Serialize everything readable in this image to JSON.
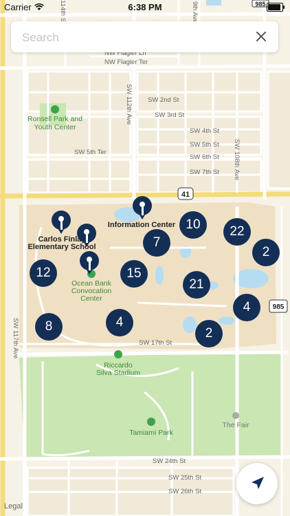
{
  "status": {
    "carrier": "Carrier",
    "time": "6:38 PM",
    "battery_level": 0.9
  },
  "search": {
    "placeholder": "Search",
    "value": ""
  },
  "map": {
    "labels": {
      "flagler_ln": "NW Flagler Ln",
      "flagler_ter": "NW Flagler Ter",
      "sw_2nd": "SW 2nd St",
      "sw_3rd": "SW 3rd St",
      "sw_4th": "SW 4th St",
      "sw_5th": "SW 5th St",
      "sw_6th": "SW 6th St",
      "sw_7th": "SW 7th St",
      "sw_5th_ter": "SW 5th Ter",
      "sw_17th": "SW 17th St",
      "sw_24th": "SW 24th St",
      "sw_25th": "SW 25th St",
      "sw_26th": "SW 26th St",
      "sw_112th": "SW 112th Ave",
      "sw_108th": "SW 108th Ave",
      "sw_117th": "SW 117th Ave",
      "ave_109": "9th Ave",
      "ave_114": "114th St",
      "ronsell": [
        "Ronsell Park and",
        "Youth Center"
      ],
      "carlos": [
        "Carlos Finlay",
        "Elementary School"
      ],
      "info_center": "Information Center",
      "ocean_bank": [
        "Ocean Bank",
        "Convocation",
        "Center"
      ],
      "riccardo": [
        "Riccardo",
        "Silva Stadium"
      ],
      "tamiami": "Tamiami Park",
      "fair": "The Fair",
      "hwy41": "41",
      "sr985": "985"
    },
    "clusters": [
      "10",
      "22",
      "7",
      "2",
      "12",
      "15",
      "21",
      "4",
      "8",
      "4",
      "2"
    ]
  },
  "legal": "Legal",
  "icons": [
    "wifi-icon",
    "battery-icon",
    "clear-icon",
    "map-pin-icon",
    "navigation-arrow-icon",
    "park-icon",
    "landmark-icon"
  ]
}
